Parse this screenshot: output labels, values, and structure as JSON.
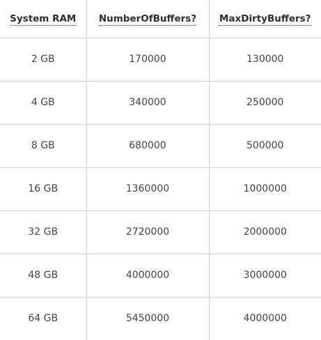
{
  "table": {
    "headers": [
      "System RAM",
      "NumberOfBuffers?",
      "MaxDirtyBuffers?"
    ],
    "rows": [
      [
        "2 GB",
        "170000",
        "130000"
      ],
      [
        "4 GB",
        "340000",
        "250000"
      ],
      [
        "8 GB",
        "680000",
        "500000"
      ],
      [
        "16 GB",
        "1360000",
        "1000000"
      ],
      [
        "32 GB",
        "2720000",
        "2000000"
      ],
      [
        "48 GB",
        "4000000",
        "3000000"
      ],
      [
        "64 GB",
        "5450000",
        "4000000"
      ]
    ]
  }
}
